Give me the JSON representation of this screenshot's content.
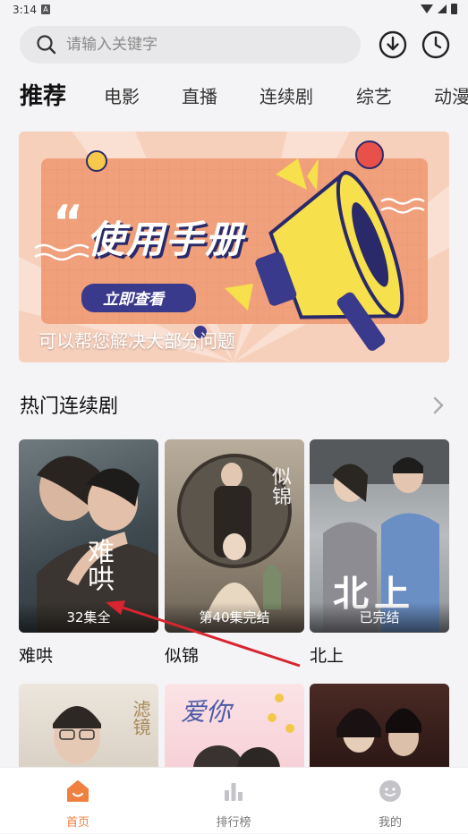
{
  "status_bar": {
    "time": "3:14",
    "notif_glyph": "A"
  },
  "search": {
    "placeholder": "请输入关键字"
  },
  "header_icons": [
    "download-icon",
    "history-icon"
  ],
  "tabs": [
    {
      "label": "推荐",
      "active": true
    },
    {
      "label": "电影"
    },
    {
      "label": "直播"
    },
    {
      "label": "连续剧"
    },
    {
      "label": "综艺"
    },
    {
      "label": "动漫"
    }
  ],
  "banner": {
    "headline": "使用手册",
    "button": "立即查看",
    "caption": "可以帮您解决大部分问题",
    "quote_glyph": "“"
  },
  "section": {
    "title": "热门连续剧"
  },
  "cards": [
    {
      "title": "难哄",
      "badge": "32集全",
      "poster_text": "难哄"
    },
    {
      "title": "似锦",
      "badge": "第40集完结",
      "poster_text": "似锦"
    },
    {
      "title": "北上",
      "badge": "已完结",
      "poster_text": "北上"
    }
  ],
  "cards_row2": [
    {
      "poster_text": "滤镜"
    },
    {
      "poster_text": "爱你"
    },
    {
      "poster_text": ""
    }
  ],
  "bottom_nav": [
    {
      "label": "首页",
      "active": true
    },
    {
      "label": "排行榜"
    },
    {
      "label": "我的"
    }
  ],
  "colors": {
    "accent": "#f08040",
    "banner_bg": "#f7cdb8",
    "board": "#f0a07a",
    "button": "#3a3a8c"
  }
}
